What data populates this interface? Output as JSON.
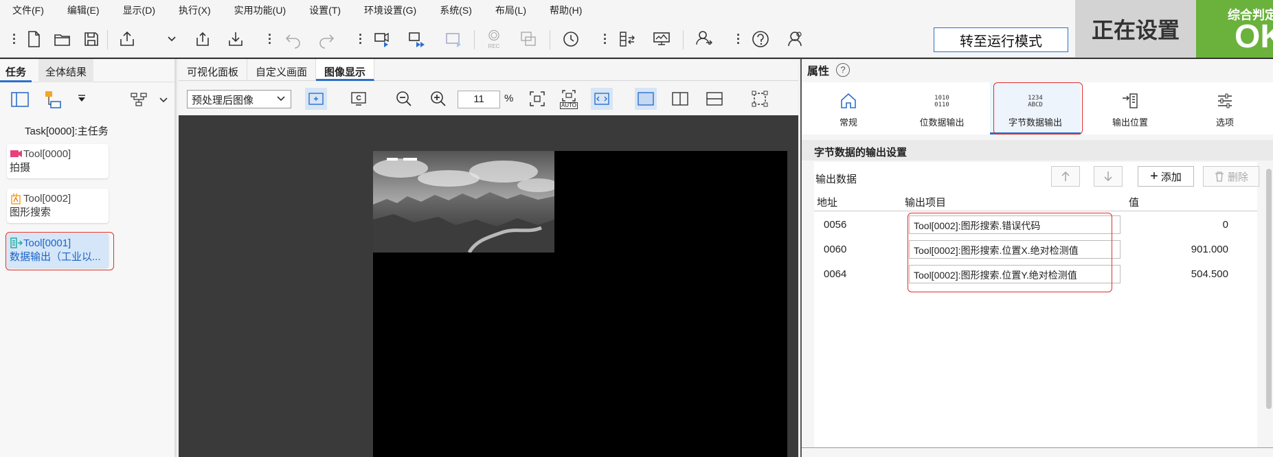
{
  "menu": [
    "文件(F)",
    "编辑(E)",
    "显示(D)",
    "执行(X)",
    "实用功能(U)",
    "设置(T)",
    "环境设置(G)",
    "系统(S)",
    "布局(L)",
    "帮助(H)"
  ],
  "toolbar": {
    "run_mode_label": "转至运行模式",
    "rec_label": "REC"
  },
  "status": {
    "setting_label": "正在设置",
    "judgement_label": "综合判定",
    "ok_label": "OK"
  },
  "left": {
    "tabs": [
      "任务",
      "全体结果"
    ],
    "task_title": "Task[0000]:主任务",
    "tools": [
      {
        "id": "Tool[0000]",
        "name": "拍摄"
      },
      {
        "id": "Tool[0002]",
        "name": "图形搜索"
      },
      {
        "id": "Tool[0001]",
        "name": "数据输出（工业以..."
      }
    ]
  },
  "center": {
    "tabs": [
      "可视化面板",
      "自定义画面",
      "图像显示"
    ],
    "image_select": "预处理后图像",
    "zoom_value": "11",
    "zoom_unit": "%",
    "auto_label": "AUTO"
  },
  "right": {
    "title": "属性",
    "help": "?",
    "tabs": [
      {
        "label": "常规",
        "icon_text": ""
      },
      {
        "label": "位数据输出",
        "icon_text": "1010\n0110"
      },
      {
        "label": "字节数据输出",
        "icon_text": "1234\nABCD"
      },
      {
        "label": "输出位置",
        "icon_text": ""
      },
      {
        "label": "选项",
        "icon_text": ""
      }
    ],
    "section_title": "字节数据的输出设置",
    "output_data_label": "输出数据",
    "add_label": "添加",
    "delete_label": "删除",
    "columns": [
      "地址",
      "输出项目",
      "值"
    ],
    "rows": [
      {
        "addr": "0056",
        "item": "Tool[0002]:图形搜索.错误代码",
        "value": "0"
      },
      {
        "addr": "0060",
        "item": "Tool[0002]:图形搜索.位置X.绝对检测值",
        "value": "901.000"
      },
      {
        "addr": "0064",
        "item": "Tool[0002]:图形搜索.位置Y.绝对检测值",
        "value": "504.500"
      }
    ]
  },
  "colors": {
    "accent": "#2b6fcc",
    "ok_green": "#6ab23c",
    "highlight_red": "#e02d2d"
  }
}
